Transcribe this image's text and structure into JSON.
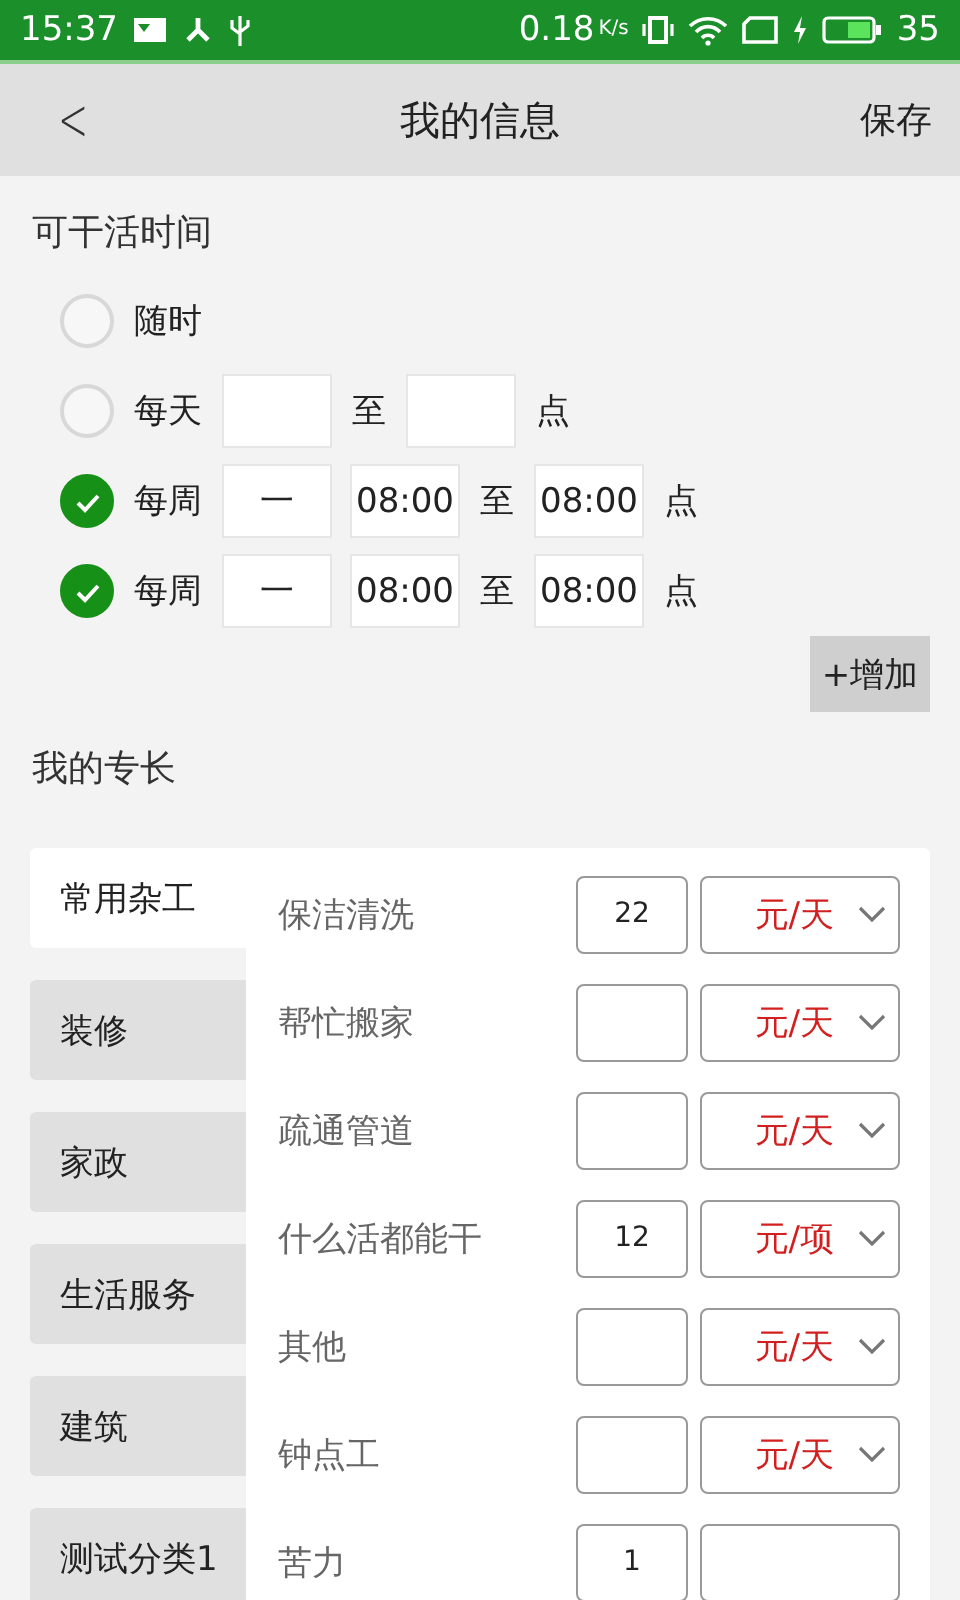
{
  "status_bar": {
    "time": "15:37",
    "speed": "0.18",
    "speed_unit": "K/s",
    "battery": "35"
  },
  "header": {
    "back": "<",
    "title": "我的信息",
    "action": "保存"
  },
  "availability": {
    "title": "可干活时间",
    "options": [
      {
        "kind": "anytime",
        "label": "随时",
        "checked": false
      },
      {
        "kind": "daily",
        "label": "每天",
        "checked": false,
        "to": "至",
        "unit": "点"
      },
      {
        "kind": "weekly",
        "label": "每周",
        "checked": true,
        "day": "一",
        "start": "08:00",
        "to": "至",
        "end": "08:00",
        "unit": "点"
      },
      {
        "kind": "weekly",
        "label": "每周",
        "checked": true,
        "day": "一",
        "start": "08:00",
        "to": "至",
        "end": "08:00",
        "unit": "点"
      }
    ],
    "add_button": "+增加"
  },
  "skills": {
    "title": "我的专长",
    "categories": [
      {
        "label": "常用杂工",
        "selected": true
      },
      {
        "label": "装修",
        "selected": false
      },
      {
        "label": "家政",
        "selected": false
      },
      {
        "label": "生活服务",
        "selected": false
      },
      {
        "label": "建筑",
        "selected": false
      },
      {
        "label": "测试分类1",
        "selected": false
      }
    ],
    "items": [
      {
        "name": "保洁清洗",
        "price": "22",
        "unit": "元/天"
      },
      {
        "name": "帮忙搬家",
        "unit": "元/天"
      },
      {
        "name": "疏通管道",
        "unit": "元/天"
      },
      {
        "name": "什么活都能干",
        "price": "12",
        "unit": "元/项"
      },
      {
        "name": "其他",
        "unit": "元/天"
      },
      {
        "name": "钟点工",
        "unit": "元/天"
      },
      {
        "name": "苦力",
        "price": "1"
      }
    ]
  }
}
